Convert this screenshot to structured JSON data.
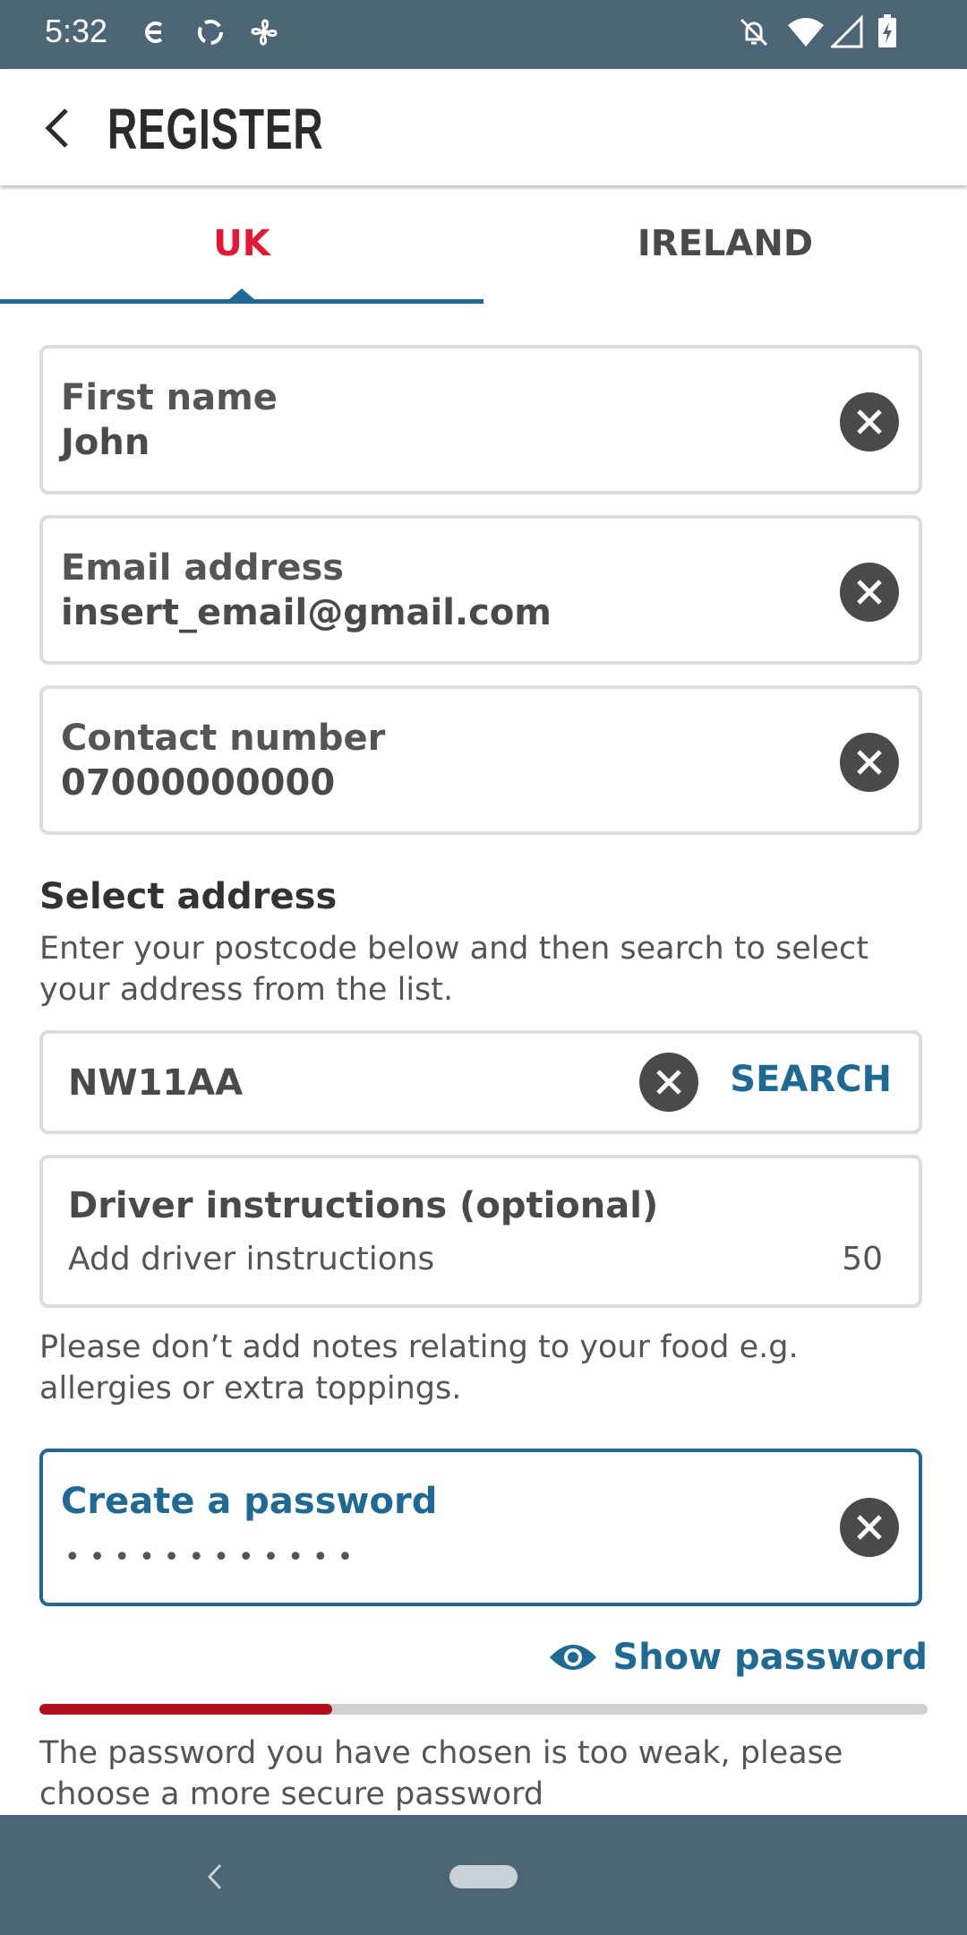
{
  "status_bar": {
    "time": "5:32",
    "left_icons": [
      "cloud-sync-icon",
      "sync-icon",
      "fan-icon"
    ],
    "right_icons": [
      "notifications-off-icon",
      "wifi-icon",
      "cellular-signal-icon",
      "battery-charging-icon"
    ]
  },
  "app_bar": {
    "title": "REGISTER",
    "back_icon": "back-arrow-icon"
  },
  "tabs": [
    {
      "label": "UK",
      "selected": true
    },
    {
      "label": "IRELAND",
      "selected": false
    }
  ],
  "form": {
    "first_name": {
      "label": "First name",
      "value": "John"
    },
    "email": {
      "label": "Email address",
      "value": "insert_email@gmail.com"
    },
    "contact": {
      "label": "Contact number",
      "value": "07000000000"
    },
    "address": {
      "title": "Select address",
      "help": "Enter your postcode below and then search to select your address from the list.",
      "postcode": "NW11AA",
      "search_label": "SEARCH"
    },
    "driver": {
      "label": "Driver instructions (optional)",
      "placeholder": "Add driver instructions",
      "counter": "50",
      "help": "Please don’t add notes relating to your food e.g. allergies or extra toppings."
    },
    "password": {
      "label": "Create a password",
      "masked": "••••••••••••",
      "show_label": "Show password",
      "strength_fraction": 0.33,
      "strength_color": "#b50f1c",
      "message": "The password you have chosen is too weak, please choose a more secure password"
    }
  },
  "colors": {
    "accent": "#1f6a94",
    "brand_red": "#e31837",
    "bars": "#4c6675"
  }
}
